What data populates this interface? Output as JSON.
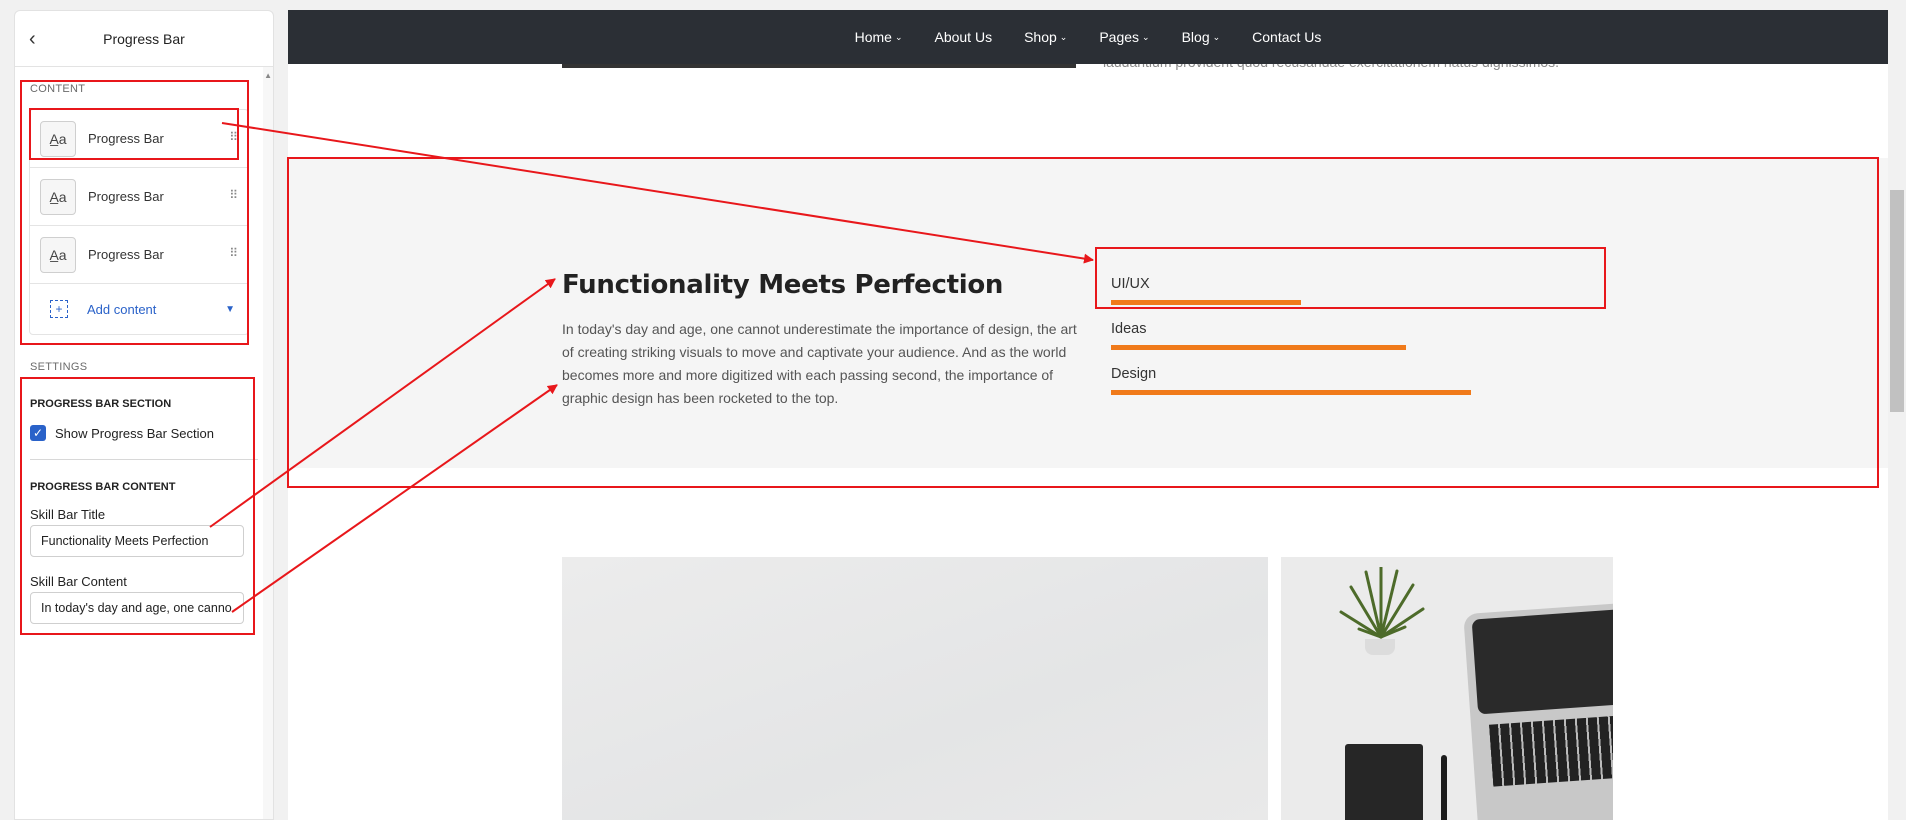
{
  "panel": {
    "title": "Progress Bar",
    "content_label": "CONTENT",
    "items": [
      {
        "label": "Progress Bar"
      },
      {
        "label": "Progress Bar"
      },
      {
        "label": "Progress Bar"
      }
    ],
    "add_content_label": "Add content",
    "settings_label": "SETTINGS",
    "section_group": "PROGRESS BAR SECTION",
    "show_section_label": "Show Progress Bar Section",
    "show_section_checked": true,
    "content_group": "PROGRESS BAR CONTENT",
    "title_field_label": "Skill Bar Title",
    "title_field_value": "Functionality Meets Perfection",
    "content_field_label": "Skill Bar Content",
    "content_field_value": "In today's day and age, one canno"
  },
  "navbar": {
    "items": [
      {
        "label": "Home",
        "has_caret": true
      },
      {
        "label": "About Us",
        "has_caret": false
      },
      {
        "label": "Shop",
        "has_caret": true
      },
      {
        "label": "Pages",
        "has_caret": true
      },
      {
        "label": "Blog",
        "has_caret": true
      },
      {
        "label": "Contact Us",
        "has_caret": false
      }
    ]
  },
  "top_strip_text": "laudantium provident quod recusandae exercitationem natus dignissimos.",
  "section": {
    "heading": "Functionality Meets Perfection",
    "paragraph": "In today's day and age, one cannot underestimate the importance of design, the art of creating striking visuals to move and captivate your audience. And as the world becomes more and more digitized with each passing second, the importance of graphic design has been rocketed to the top.",
    "skills": [
      {
        "label": "UI/UX",
        "percent": 38
      },
      {
        "label": "Ideas",
        "percent": 59
      },
      {
        "label": "Design",
        "percent": 72
      }
    ]
  },
  "colors": {
    "accent": "#f07a1a",
    "navbar": "#2b2f35",
    "annotation": "#e8171b",
    "link": "#2a62c9"
  }
}
